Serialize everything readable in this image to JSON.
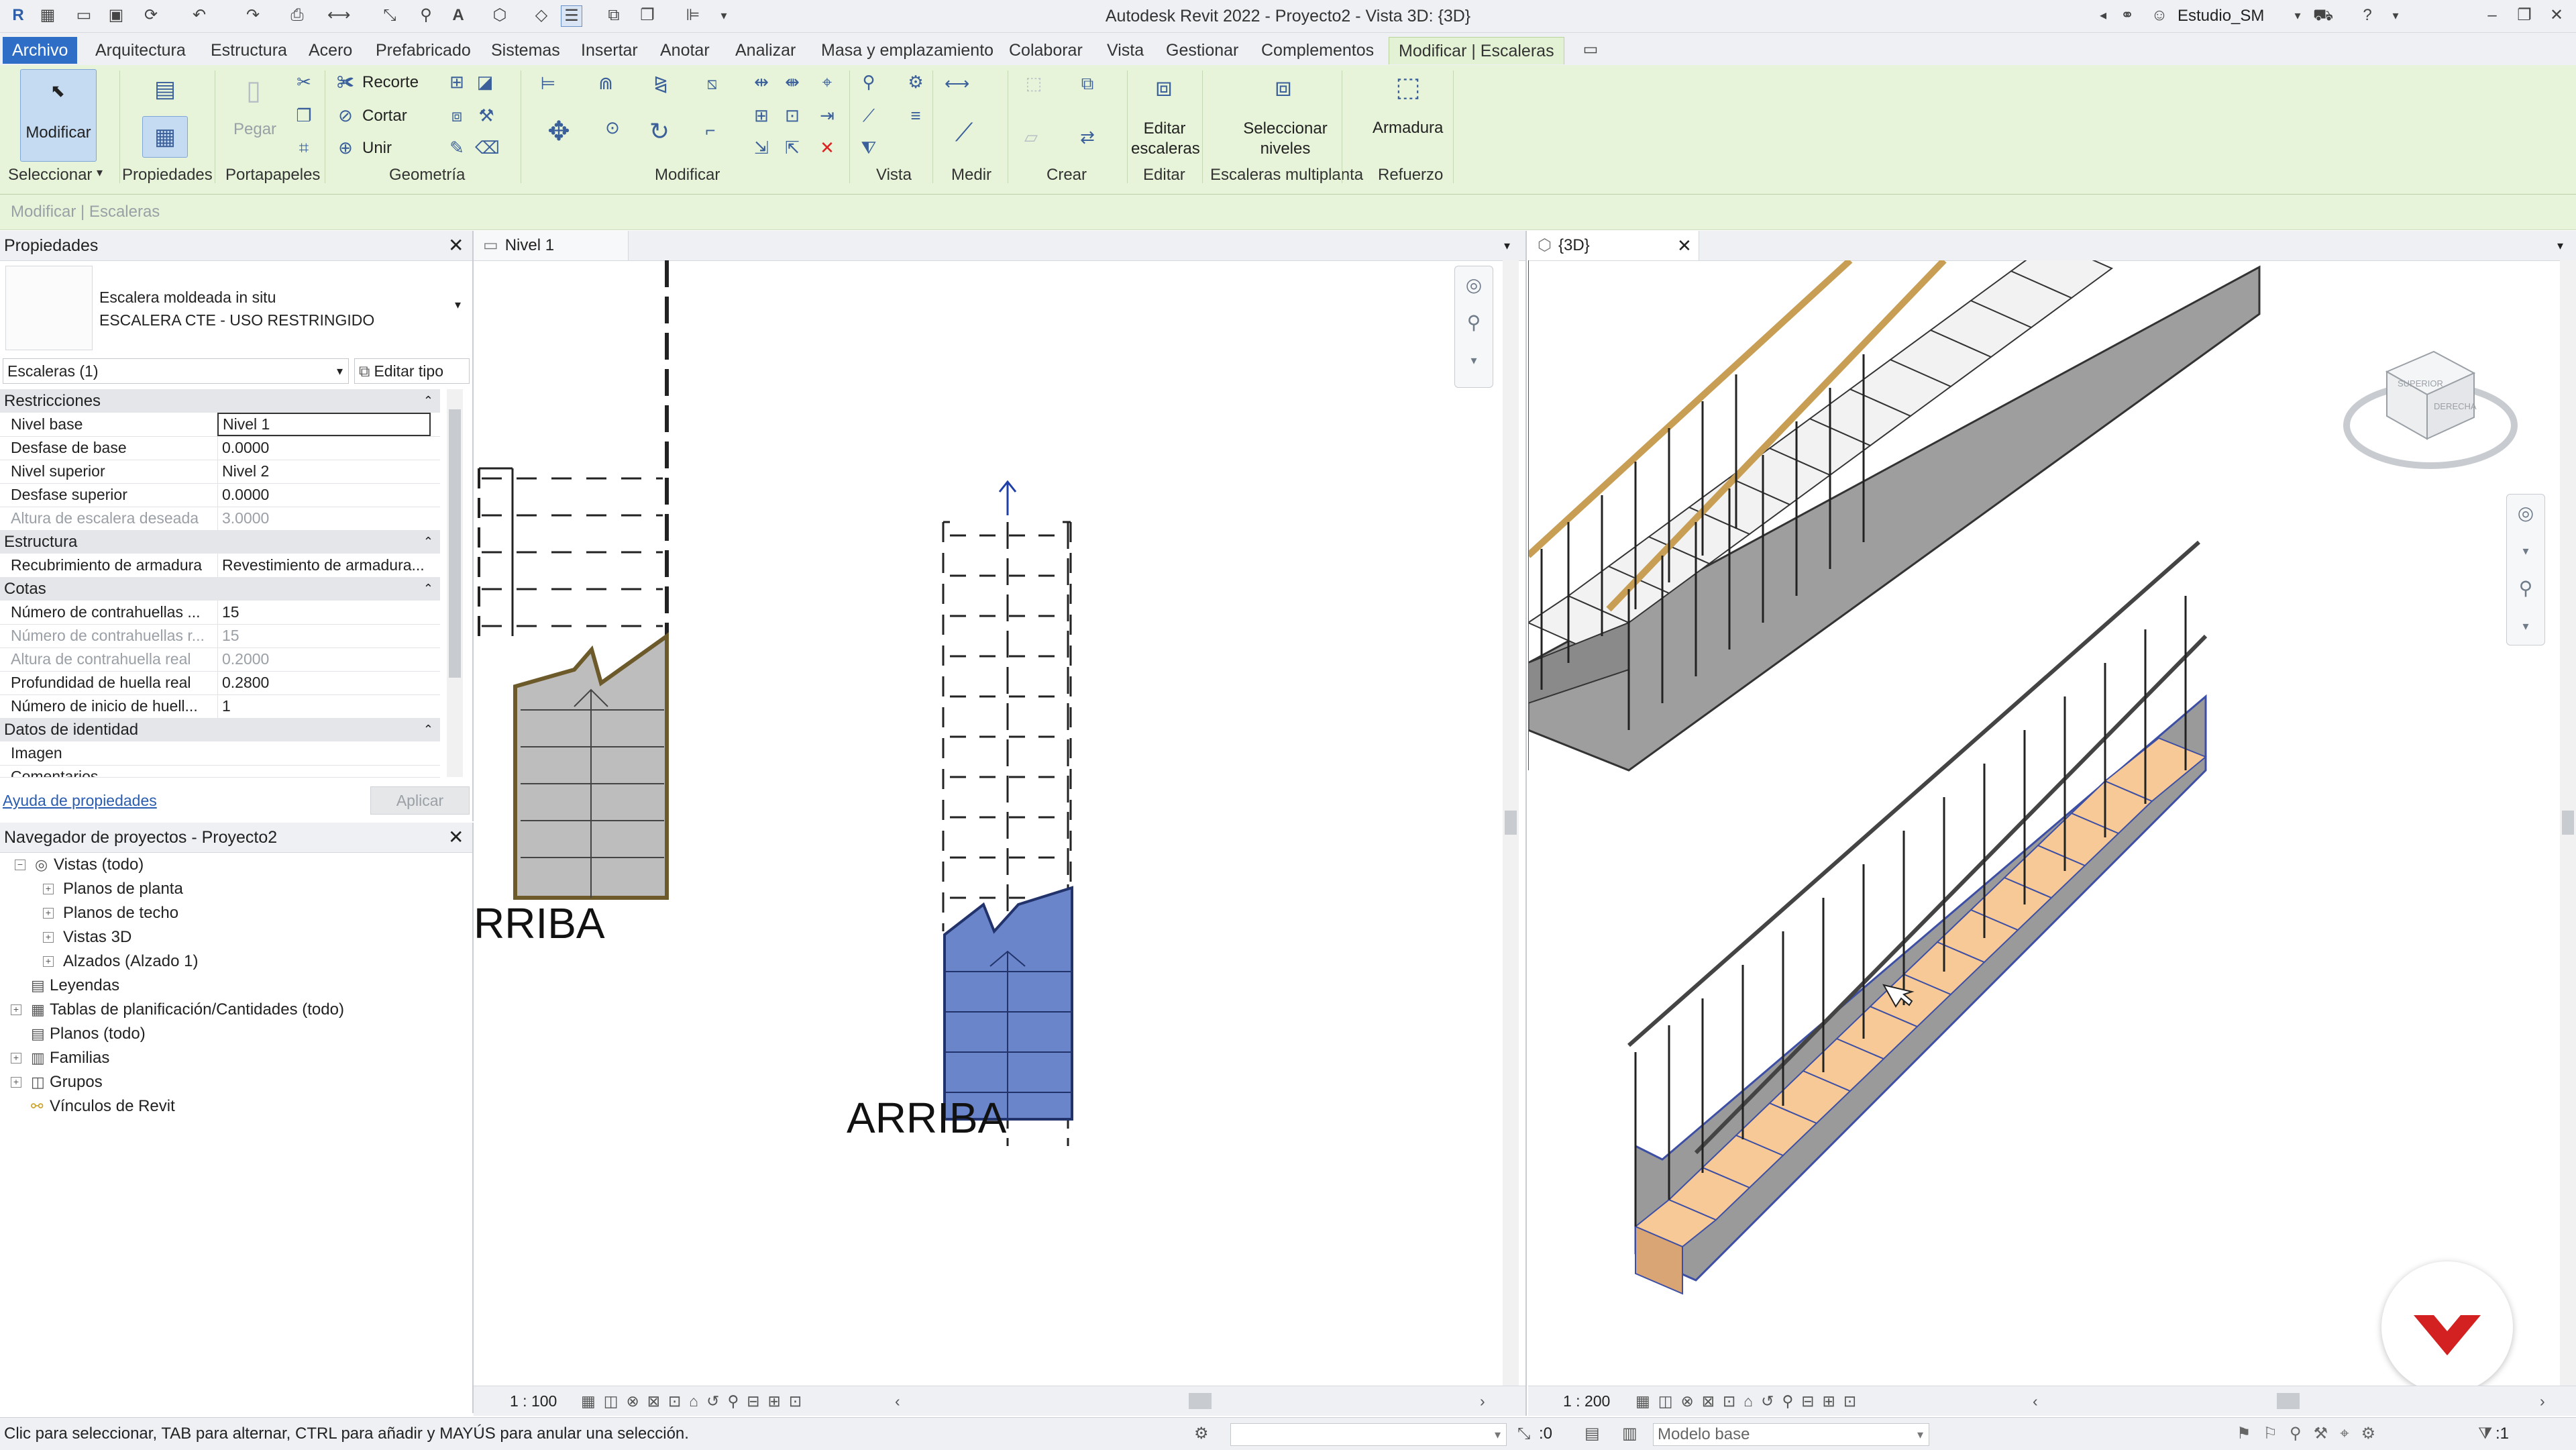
{
  "app": {
    "title": "Autodesk Revit 2022 - Proyecto2 - Vista 3D: {3D}",
    "user": "Estudio_SM"
  },
  "menu_tabs": [
    "Archivo",
    "Arquitectura",
    "Estructura",
    "Acero",
    "Prefabricado",
    "Sistemas",
    "Insertar",
    "Anotar",
    "Analizar",
    "Masa y emplazamiento",
    "Colaborar",
    "Vista",
    "Gestionar",
    "Complementos",
    "Modificar | Escaleras"
  ],
  "ribbon": {
    "modify_label": "Modificar",
    "paste_label": "Pegar",
    "recorte_label": "Recorte",
    "cortar_label": "Cortar",
    "unir_label": "Unir",
    "edit_stairs_label": "Editar escaleras",
    "select_levels_label": "Seleccionar niveles",
    "armadura_label": "Armadura",
    "panels": [
      "Seleccionar",
      "Propiedades",
      "Portapapeles",
      "Geometría",
      "Modificar",
      "Vista",
      "Medir",
      "Crear",
      "Editar",
      "Escaleras multiplanta",
      "Refuerzo"
    ]
  },
  "context_bar": "Modificar | Escaleras",
  "properties": {
    "title": "Propiedades",
    "type_line1": "Escalera moldeada in situ",
    "type_line2": "ESCALERA CTE - USO RESTRINGIDO",
    "filter": "Escaleras (1)",
    "edit_type": "Editar tipo",
    "sections": {
      "restricciones": "Restricciones",
      "estructura": "Estructura",
      "cotas": "Cotas",
      "identidad": "Datos de identidad"
    },
    "rows": {
      "nivel_base": {
        "k": "Nivel base",
        "v": "Nivel 1"
      },
      "desfase_base": {
        "k": "Desfase de base",
        "v": "0.0000"
      },
      "nivel_superior": {
        "k": "Nivel superior",
        "v": "Nivel 2"
      },
      "desfase_superior": {
        "k": "Desfase superior",
        "v": "0.0000"
      },
      "altura_deseada": {
        "k": "Altura de escalera deseada",
        "v": "3.0000"
      },
      "recubrimiento": {
        "k": "Recubrimiento de armadura",
        "v": "Revestimiento de armadura..."
      },
      "num_contrahuellas": {
        "k": "Número de contrahuellas ...",
        "v": "15"
      },
      "num_contrahuellas_r": {
        "k": "Número de contrahuellas r...",
        "v": "15"
      },
      "altura_contrahuella": {
        "k": "Altura de contrahuella real",
        "v": "0.2000"
      },
      "profundidad_huella": {
        "k": "Profundidad de huella real",
        "v": "0.2800"
      },
      "inicio_huella": {
        "k": "Número de inicio de huell...",
        "v": "1"
      },
      "imagen": {
        "k": "Imagen",
        "v": ""
      },
      "comentarios": {
        "k": "Comentarios",
        "v": ""
      }
    },
    "help_link": "Ayuda de propiedades",
    "apply": "Aplicar"
  },
  "browser": {
    "title": "Navegador de proyectos - Proyecto2",
    "items": [
      "Vistas (todo)",
      "Planos de planta",
      "Planos de techo",
      "Vistas 3D",
      "Alzados (Alzado 1)",
      "Leyendas",
      "Tablas de planificación/Cantidades (todo)",
      "Planos (todo)",
      "Familias",
      "Grupos",
      "Vínculos de Revit"
    ]
  },
  "views": {
    "plan_tab": "Nivel 1",
    "view3d_tab": "{3D}",
    "plan_scale": "1 : 100",
    "view3d_scale": "1 : 200",
    "arriba_label": "ARRIBA",
    "arriba_label_cut": "RRIBA",
    "viewcube_left": "SUPERIOR",
    "viewcube_right": "DERECHA"
  },
  "status": {
    "hint": "Clic para seleccionar, TAB para alternar, CTRL para añadir y MAYÚS para anular una selección.",
    "model": "Modelo base",
    "zero": ":0",
    "filter_count": ":1"
  },
  "colors": {
    "accent": "#2f6ec6",
    "ribbon": "#e7f4d9",
    "stair_fill": "#f7c996",
    "selection_blue": "#6a85c9",
    "brand_red": "#d32020"
  }
}
